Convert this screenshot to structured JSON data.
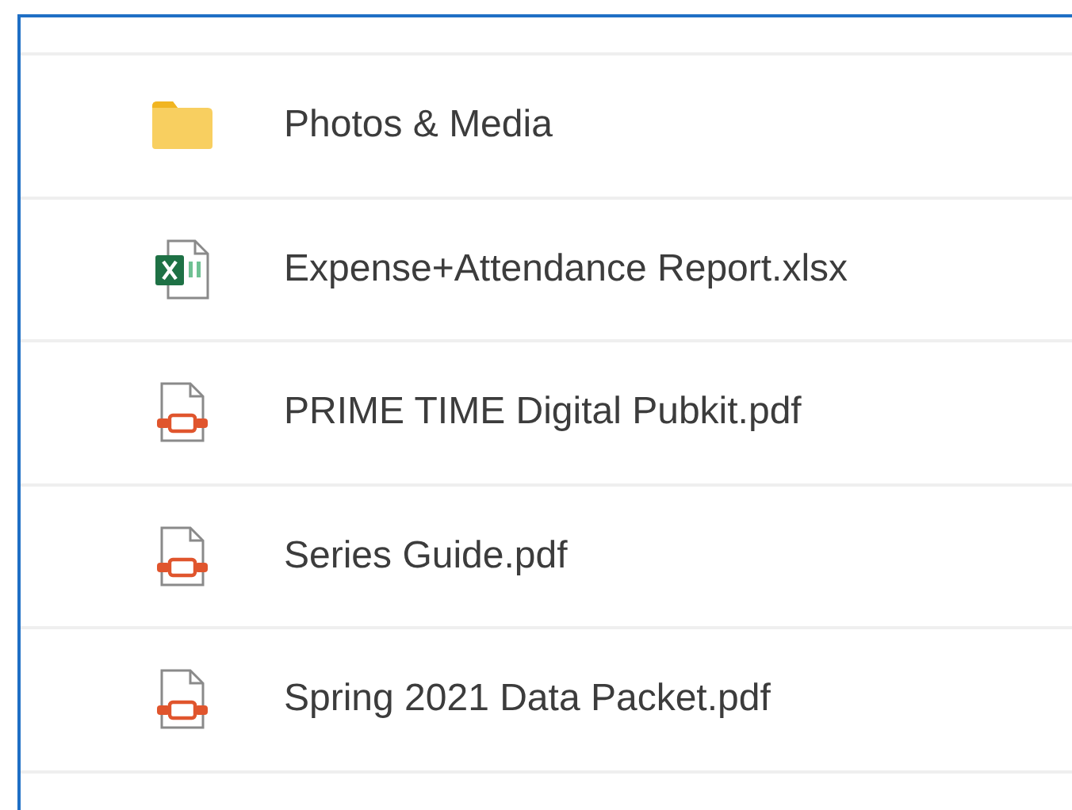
{
  "files": [
    {
      "kind": "folder",
      "name": "Photos & Media"
    },
    {
      "kind": "excel",
      "name": "Expense+Attendance Report.xlsx"
    },
    {
      "kind": "pdf",
      "name": "PRIME TIME Digital Pubkit.pdf"
    },
    {
      "kind": "pdf",
      "name": "Series Guide.pdf"
    },
    {
      "kind": "pdf",
      "name": "Spring 2021 Data Packet.pdf"
    }
  ]
}
